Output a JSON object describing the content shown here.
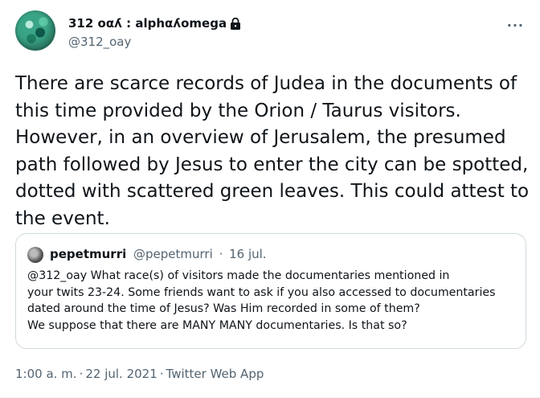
{
  "author": {
    "display_name": "312 οαʎ : alphαʎomega",
    "handle": "@312_oay",
    "avatar_icon": "planet-avatar",
    "protected_icon": "lock-icon"
  },
  "menu": {
    "more_label": "···"
  },
  "tweet": {
    "text": "There are scarce records of Judea in the documents of\nthis time provided by the Orion / Taurus visitors.\nHowever, in an overview of Jerusalem, the presumed\npath followed by Jesus to enter the city can be spotted,\ndotted with scattered green leaves. This could attest to\nthe event."
  },
  "quoted": {
    "name": "pepetmurri",
    "handle": "@pepetmurri",
    "date": "16 jul.",
    "text": "@312_oay What race(s) of visitors made the documentaries mentioned in\nyour twits 23-24. Some friends want to ask if you also accessed to documentaries\ndated around the time of Jesus? Was Him recorded in some of them?\nWe suppose that there are MANY MANY documentaries. Is that so?"
  },
  "meta": {
    "time": "1:00 a. m.",
    "date": "22 jul. 2021",
    "source": "Twitter Web App",
    "separator": "·"
  },
  "colors": {
    "secondary_text": "#536471",
    "border": "#cfd9de",
    "primary_text": "#0f1419"
  }
}
